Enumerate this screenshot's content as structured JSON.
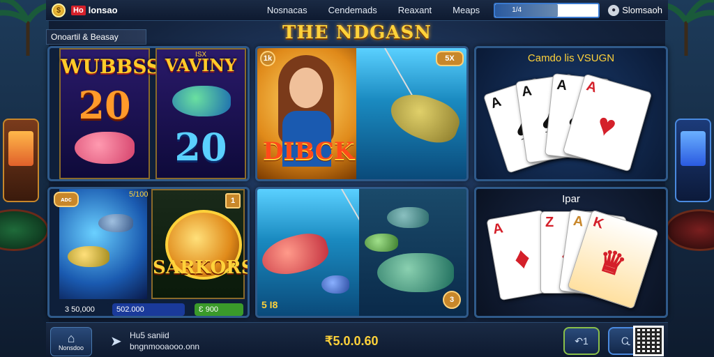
{
  "header": {
    "brand_badge": "Ho",
    "brand_name": "lonsao",
    "nav": [
      "Nosnacas",
      "Cendemads",
      "Reaxant",
      "Meaps"
    ],
    "search_chip": "1/4",
    "user_name": "Slomsaoh"
  },
  "page": {
    "section_title": "Onoartil & Beasay",
    "main_title": "THE NDGASN"
  },
  "tiles": {
    "slots": {
      "title_left": "WUBBSS",
      "num_left": "20",
      "title_right": "VAVINY",
      "num_right": "20",
      "tag_right": "ISX"
    },
    "fishing": {
      "badge": "1k",
      "label": "DIBCK",
      "corner": "5X"
    },
    "cards_top": {
      "title": "Camdo lis VSUGN",
      "cards": [
        "A",
        "A",
        "A",
        "A"
      ]
    },
    "sarkors": {
      "badge": "ᴀᴅᴄ",
      "tag": "5/100",
      "num": "1",
      "label": "SARKORS",
      "pill1": "3 50,000",
      "pill2": "502.000",
      "pill3": "Ɛ 900"
    },
    "fishing2": {
      "left_badge": "5 I8",
      "right_badge": "3"
    },
    "cards_bottom": {
      "title": "Ipar",
      "cards": [
        "A",
        "Z",
        "A",
        "K"
      ]
    }
  },
  "footer": {
    "home_label": "Nonsdoo",
    "line1": "Hu5 saniid",
    "line2": "bngnmooaooo.onn",
    "balance": "₹5.0.0.60",
    "action1": "↶1",
    "action2": "Ꮹ"
  },
  "colors": {
    "accent": "#ffd23a",
    "frame": "#2f5a8a",
    "background": "#14243f"
  }
}
